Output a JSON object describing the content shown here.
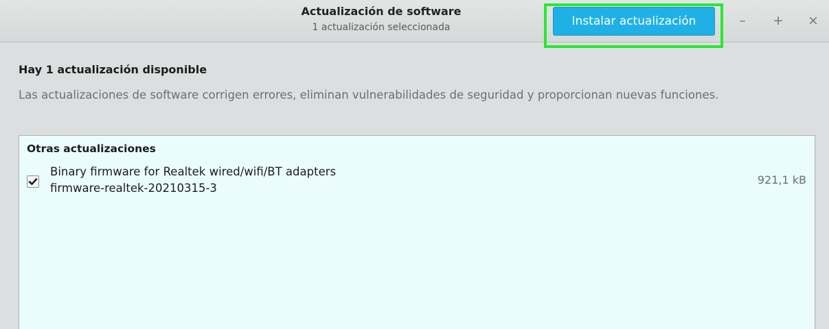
{
  "window": {
    "title": "Actualización de software",
    "subtitle": "1 actualización seleccionada",
    "install_label": "Instalar actualización",
    "controls": {
      "minimize": "–",
      "maximize": "+",
      "close": "×"
    }
  },
  "main": {
    "heading": "Hay 1 actualización disponible",
    "description": "Las actualizaciones de software corrigen errores, eliminan vulnerabilidades de seguridad y proporcionan nuevas funciones.",
    "section_title": "Otras actualizaciones",
    "updates": [
      {
        "name": "Binary firmware for Realtek wired/wifi/BT adapters",
        "version": "firmware-realtek-20210315-3",
        "size": "921,1  kB",
        "checked": true
      }
    ]
  },
  "colors": {
    "accent": "#1fb1e6",
    "focus_highlight": "#27e834",
    "panel_background": "#ebfcfd"
  }
}
